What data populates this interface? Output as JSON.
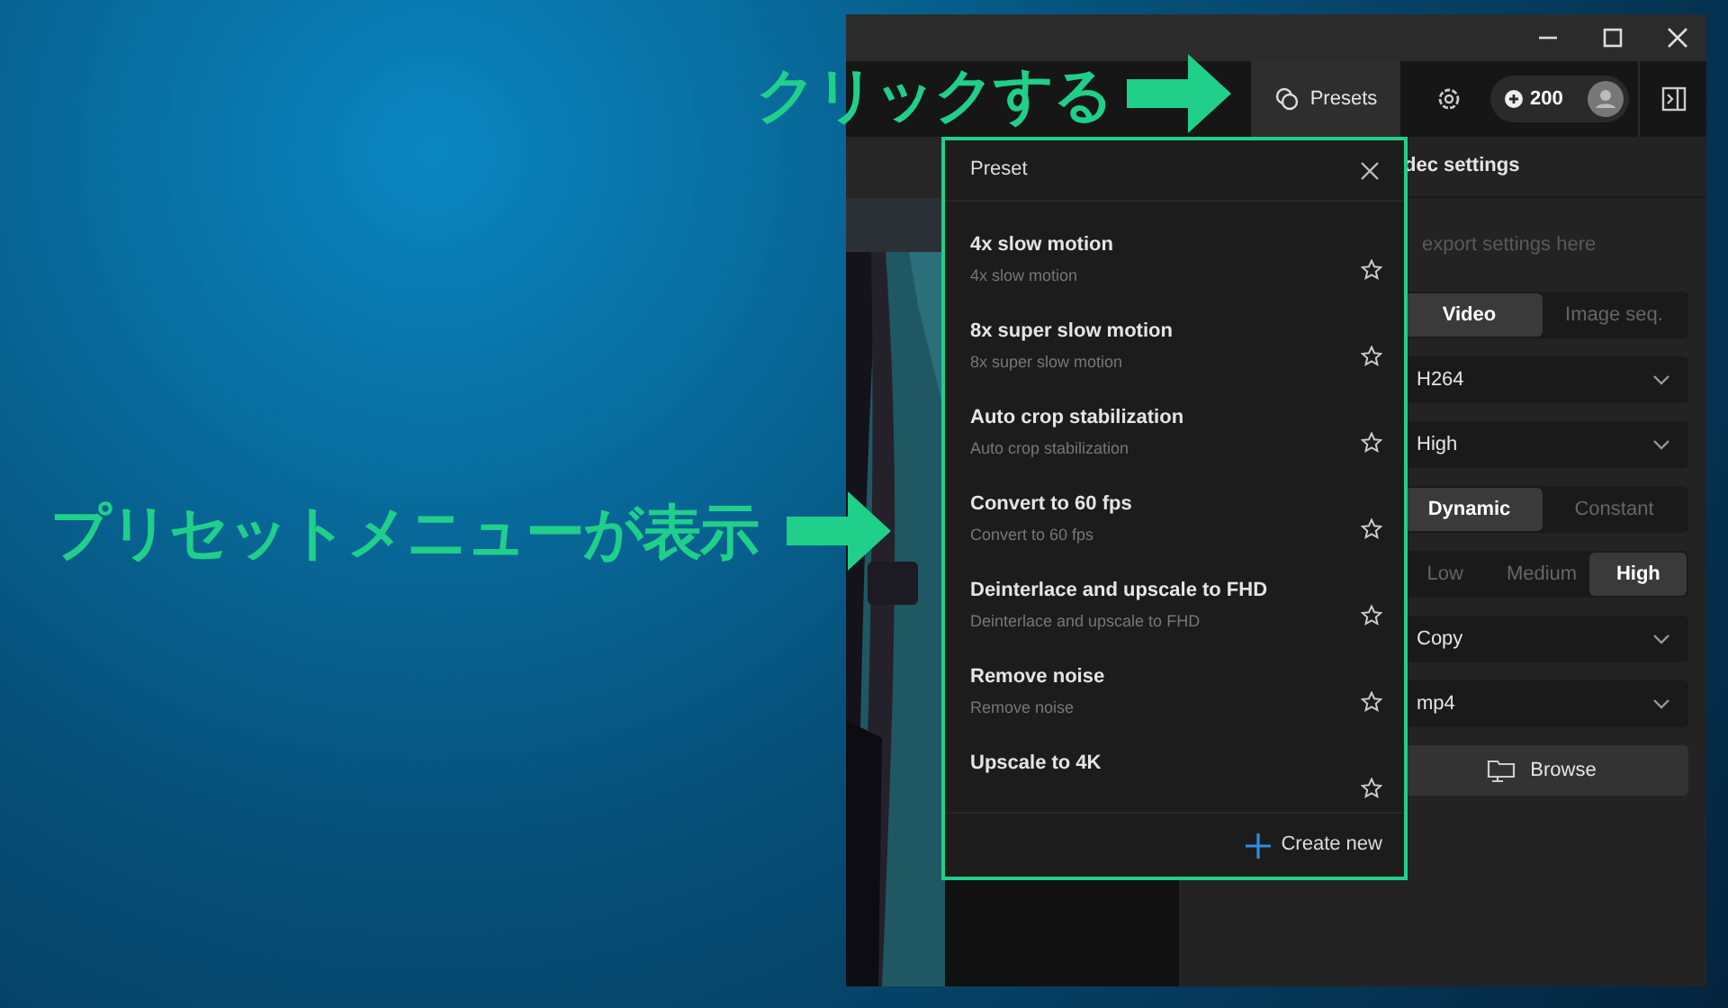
{
  "annotations": [
    {
      "text": "クリックする"
    },
    {
      "text": "プリセットメニューが表示"
    }
  ],
  "toolbar": {
    "presets_button": "Presets",
    "credits": "200"
  },
  "preset_menu": {
    "title": "Preset",
    "items": [
      {
        "name": "4x slow motion",
        "subtitle": "4x slow motion"
      },
      {
        "name": "8x super slow motion",
        "subtitle": "8x super slow motion"
      },
      {
        "name": "Auto crop stabilization",
        "subtitle": "Auto crop stabilization"
      },
      {
        "name": "Convert to 60 fps",
        "subtitle": "Convert to 60 fps"
      },
      {
        "name": "Deinterlace and upscale to FHD",
        "subtitle": "Deinterlace and upscale to FHD"
      },
      {
        "name": "Remove noise",
        "subtitle": "Remove noise"
      },
      {
        "name": "Upscale to 4K"
      }
    ],
    "create_button": "Create new"
  },
  "codec_panel": {
    "title": "dec settings",
    "hint": "export settings here",
    "rows": [
      {
        "kind": "segmented",
        "options": [
          {
            "label": "Video",
            "selected": true
          },
          {
            "label": "Image seq.",
            "selected": false
          }
        ]
      },
      {
        "kind": "dropdown",
        "value": "H264"
      },
      {
        "kind": "dropdown",
        "value": "High"
      },
      {
        "kind": "segmented",
        "options": [
          {
            "label": "Dynamic",
            "selected": true
          },
          {
            "label": "Constant",
            "selected": false
          }
        ]
      },
      {
        "kind": "segmented",
        "options": [
          {
            "label": "Low",
            "selected": false
          },
          {
            "label": "Medium",
            "selected": false
          },
          {
            "label": "High",
            "selected": true
          }
        ]
      },
      {
        "kind": "dropdown",
        "value": "Copy"
      },
      {
        "kind": "dropdown",
        "value": "mp4"
      },
      {
        "kind": "button",
        "label": "Browse"
      }
    ]
  }
}
